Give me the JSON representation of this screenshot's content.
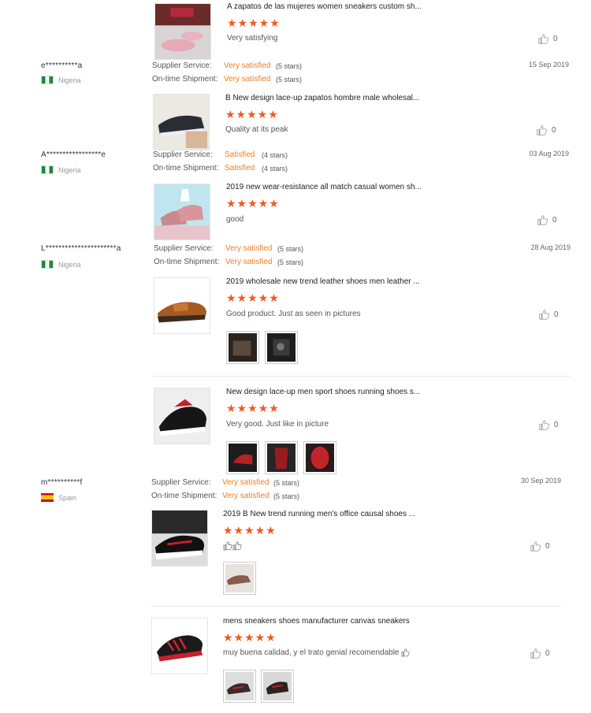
{
  "reviews": [
    {
      "reviewer": {
        "name": "",
        "country": ""
      },
      "supplier_service": {
        "label": "",
        "value": "",
        "stars": ""
      },
      "shipment": {
        "label": "",
        "value": "",
        "stars": ""
      },
      "date": "",
      "product": {
        "title": "A zapatos de las mujeres women sneakers custom sh...",
        "rating": "★★★★★",
        "comment": "Very satisfying",
        "likes": "0"
      }
    },
    {
      "reviewer": {
        "name": "e**********a",
        "country": "Nigeria"
      },
      "supplier_service": {
        "label": "Supplier Service:",
        "value": "Very satisfied",
        "stars": "(5 stars)"
      },
      "shipment": {
        "label": "On-time Shipment:",
        "value": "Very satisfied",
        "stars": "(5 stars)"
      },
      "date": "15 Sep 2019",
      "product": {
        "title": "B New design lace-up zapatos hombre male wholesal...",
        "rating": "★★★★★",
        "comment": "Quality at its peak",
        "likes": "0"
      }
    },
    {
      "reviewer": {
        "name": "A*****************e",
        "country": "Nigeria"
      },
      "supplier_service": {
        "label": "Supplier Service:",
        "value": "Satisfied",
        "stars": "(4 stars)"
      },
      "shipment": {
        "label": "On-time Shipment:",
        "value": "Satisfied",
        "stars": "(4 stars)"
      },
      "date": "03 Aug 2019",
      "product": {
        "title": "2019 new wear-resistance all match casual women sh...",
        "rating": "★★★★★",
        "comment": "good",
        "likes": "0"
      }
    },
    {
      "reviewer": {
        "name": "L**********************a",
        "country": "Nigeria"
      },
      "supplier_service": {
        "label": "Supplier Service:",
        "value": "Very satisfied",
        "stars": "(5 stars)"
      },
      "shipment": {
        "label": "On-time Shipment:",
        "value": "Very satisfied",
        "stars": "(5 stars)"
      },
      "date": "28 Aug 2019",
      "products": [
        {
          "title": "2019 wholesale new trend leather shoes men leather ...",
          "rating": "★★★★★",
          "comment": "Good product. Just as seen in pictures",
          "likes": "0"
        },
        {
          "title": "New design lace-up men sport shoes running shoes s...",
          "rating": "★★★★★",
          "comment": "Very good. Just like in picture",
          "likes": "0"
        }
      ]
    },
    {
      "reviewer": {
        "name": "m**********f",
        "country": "Spain"
      },
      "supplier_service": {
        "label": "Supplier Service:",
        "value": "Very satisfied",
        "stars": "(5 stars)"
      },
      "shipment": {
        "label": "On-time Shipment:",
        "value": "Very satisfied",
        "stars": "(5 stars)"
      },
      "date": "30 Sep 2019",
      "products": [
        {
          "title": "2019 B New trend running men's office causal shoes ...",
          "rating": "★★★★★",
          "comment": "",
          "likes": "0"
        },
        {
          "title": "mens sneakers shoes manufacturer canvas sneakers",
          "rating": "★★★★★",
          "comment": "muy buena calidad, y el trato genial recomendable",
          "likes": "0"
        }
      ]
    }
  ],
  "colors": {
    "accent": "#f47c20",
    "stars": "#f4581e"
  },
  "icons": {
    "like": "thumbs-up-icon"
  }
}
